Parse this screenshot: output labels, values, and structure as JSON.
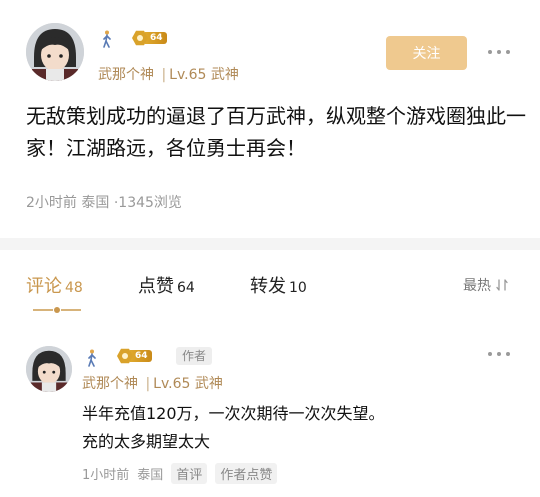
{
  "post": {
    "author": {
      "name": "武那个神",
      "level": "Lv.65",
      "title": "武神",
      "separator": "|",
      "medal_level": "64"
    },
    "follow_label": "关注",
    "content": "无敌策划成功的逼退了百万武神，纵观整个游戏圈独此一家！江湖路远，各位勇士再会！",
    "meta": {
      "time": "2小时前",
      "location": "泰国",
      "dot": "·",
      "views": "1345浏览"
    }
  },
  "tabs": [
    {
      "label": "评论",
      "count": "48",
      "active": true
    },
    {
      "label": "点赞",
      "count": "64",
      "active": false
    },
    {
      "label": "转发",
      "count": "10",
      "active": false
    }
  ],
  "sort_label": "最热",
  "comment": {
    "author": {
      "name": "武那个神",
      "level": "Lv.65",
      "title": "武神",
      "separator": "|",
      "medal_level": "64",
      "tag": "作者"
    },
    "line1": "半年充值120万，一次次期待一次次失望。",
    "line2": "充的太多期望太大",
    "meta": {
      "time": "1小时前",
      "location": "泰国",
      "chip1": "首评",
      "chip2": "作者点赞"
    }
  },
  "colors": {
    "accent": "#c9974e",
    "username": "#b08a57",
    "follow_bg": "#efc98f",
    "muted": "#999999"
  }
}
